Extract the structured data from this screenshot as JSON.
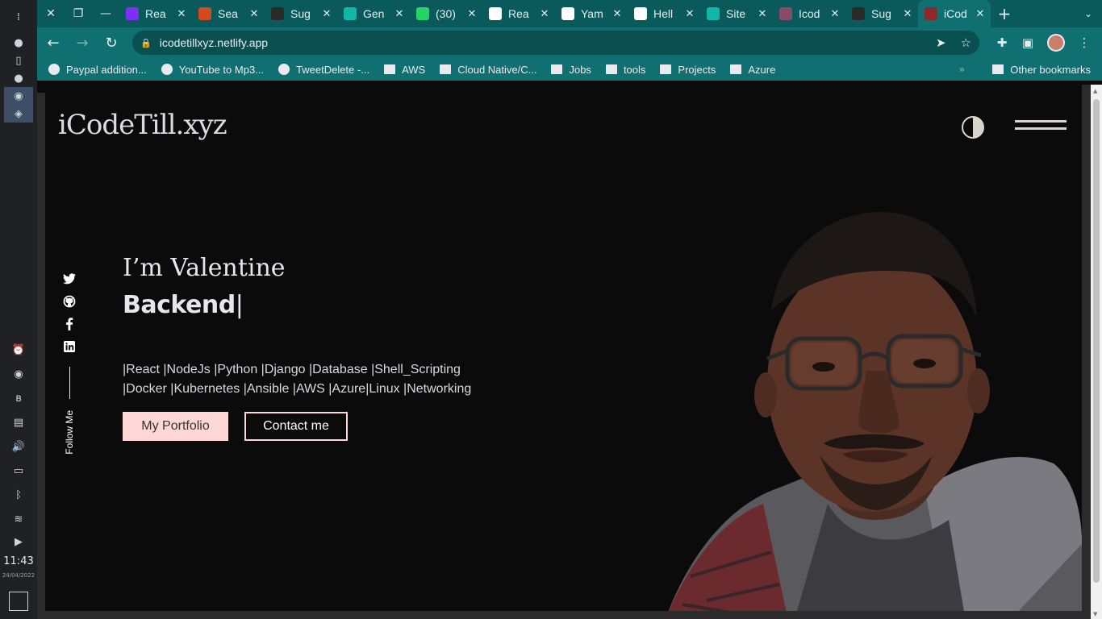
{
  "dock": {
    "clock": "11:43",
    "date": "24/04/2022"
  },
  "tabs": [
    {
      "label": "Rea",
      "favicon_color": "#7b2ff7"
    },
    {
      "label": "Sea",
      "favicon_color": "#d14b1f"
    },
    {
      "label": "Sug",
      "favicon_color": "#2a2a2a"
    },
    {
      "label": "Gen",
      "favicon_color": "#12b5a8"
    },
    {
      "label": "(30)",
      "favicon_color": "#25d366"
    },
    {
      "label": "Rea",
      "favicon_color": "#ffffff"
    },
    {
      "label": "Yam",
      "favicon_color": "#ffffff"
    },
    {
      "label": "Hell",
      "favicon_color": "#ffffff"
    },
    {
      "label": "Site",
      "favicon_color": "#12b5a8"
    },
    {
      "label": "Icod",
      "favicon_color": "#8a4a6a"
    },
    {
      "label": "Sug",
      "favicon_color": "#2a2a2a"
    },
    {
      "label": "iCod",
      "favicon_color": "#8a2a2a"
    }
  ],
  "address": {
    "url": "icodetillxyz.netlify.app"
  },
  "bookmarks": [
    {
      "label": "Paypal addition...",
      "type": "site"
    },
    {
      "label": "YouTube to Mp3...",
      "type": "site"
    },
    {
      "label": "TweetDelete -...",
      "type": "site"
    },
    {
      "label": "AWS",
      "type": "folder"
    },
    {
      "label": "Cloud Native/C...",
      "type": "folder"
    },
    {
      "label": "Jobs",
      "type": "folder"
    },
    {
      "label": "tools",
      "type": "folder"
    },
    {
      "label": "Projects",
      "type": "folder"
    },
    {
      "label": "Azure",
      "type": "folder"
    }
  ],
  "other_bookmarks": "Other bookmarks",
  "site": {
    "logo": "iCodeTill.xyz",
    "greeting": "I’m Valentine",
    "role": "Backend",
    "cursor": "|",
    "skills_line1": "|React |NodeJs |Python |Django |Database |Shell_Scripting",
    "skills_line2": "|Docker |Kubernetes |Ansible |AWS |Azure|Linux |Networking",
    "portfolio_button": "My Portfolio",
    "contact_button": "Contact me",
    "follow_label": "Follow Me",
    "colors": {
      "background": "#0c0b0b",
      "accent": "#ffd7d7",
      "text": "#e7e6ea"
    }
  }
}
